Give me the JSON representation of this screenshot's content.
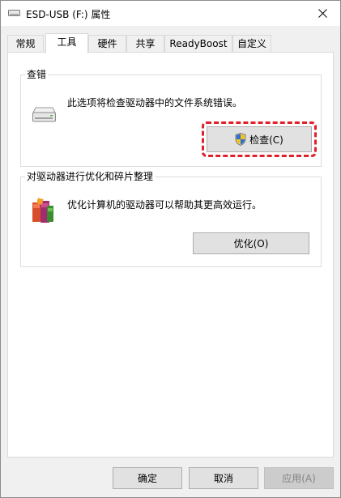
{
  "window": {
    "title": "ESD-USB (F:) 属性",
    "close_symbol": "✕"
  },
  "tabs": [
    {
      "label": "常规",
      "active": false
    },
    {
      "label": "工具",
      "active": true
    },
    {
      "label": "硬件",
      "active": false
    },
    {
      "label": "共享",
      "active": false
    },
    {
      "label": "ReadyBoost",
      "active": false
    },
    {
      "label": "自定义",
      "active": false
    }
  ],
  "error_check": {
    "group_label": "查错",
    "description": "此选项将检查驱动器中的文件系统错误。",
    "button_label": "检查(C)",
    "icon": "drive-icon",
    "button_icon": "uac-shield-icon"
  },
  "optimize": {
    "group_label": "对驱动器进行优化和碎片整理",
    "description": "优化计算机的驱动器可以帮助其更高效运行。",
    "button_label": "优化(O)",
    "icon": "defrag-icon"
  },
  "footer": {
    "ok_label": "确定",
    "cancel_label": "取消",
    "apply_label": "应用(A)"
  },
  "colors": {
    "highlight": "#e0202a",
    "disabled_text": "#838383"
  }
}
